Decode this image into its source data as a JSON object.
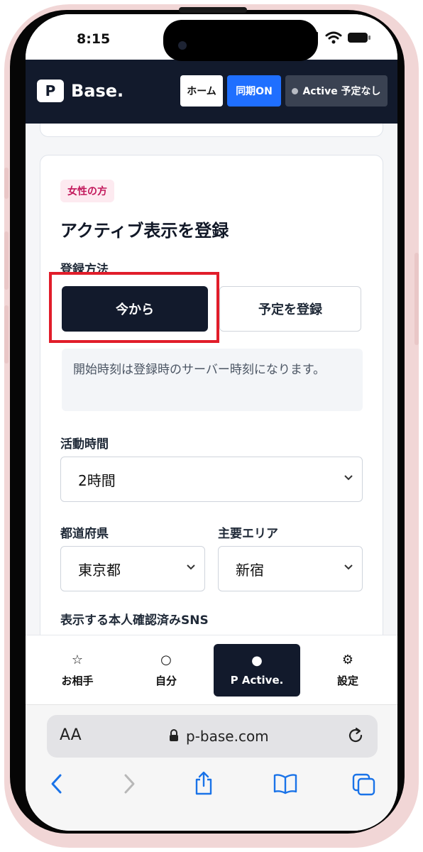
{
  "status_bar": {
    "time": "8:15"
  },
  "header": {
    "logo_letter": "P",
    "logo_text": "Base.",
    "home_label": "ホーム",
    "sync_label": "同期ON",
    "active_label": "Active 予定なし"
  },
  "form": {
    "badge": "女性の方",
    "title": "アクティブ表示を登録",
    "method_label": "登録方法",
    "method_now": "今から",
    "method_schedule": "予定を登録",
    "info_text": "開始時刻は登録時のサーバー時刻になります。",
    "duration_label": "活動時間",
    "duration_value": "2時間",
    "prefecture_label": "都道府県",
    "prefecture_value": "東京都",
    "area_label": "主要エリア",
    "area_value": "新宿",
    "sns_label": "表示する本人確認済みSNS"
  },
  "tabs": [
    {
      "icon": "☆",
      "label": "お相手"
    },
    {
      "icon": "○",
      "label": "自分"
    },
    {
      "icon": "●",
      "label": "P Active."
    },
    {
      "icon": "⚙",
      "label": "設定"
    }
  ],
  "browser": {
    "aa_label": "AA",
    "url": "p-base.com"
  },
  "colors": {
    "header_bg": "#121a2c",
    "sync_blue": "#1f6fff",
    "highlight_red": "#e11d2a",
    "badge_pink": "#c2185b",
    "browser_blue": "#1a73e8"
  }
}
